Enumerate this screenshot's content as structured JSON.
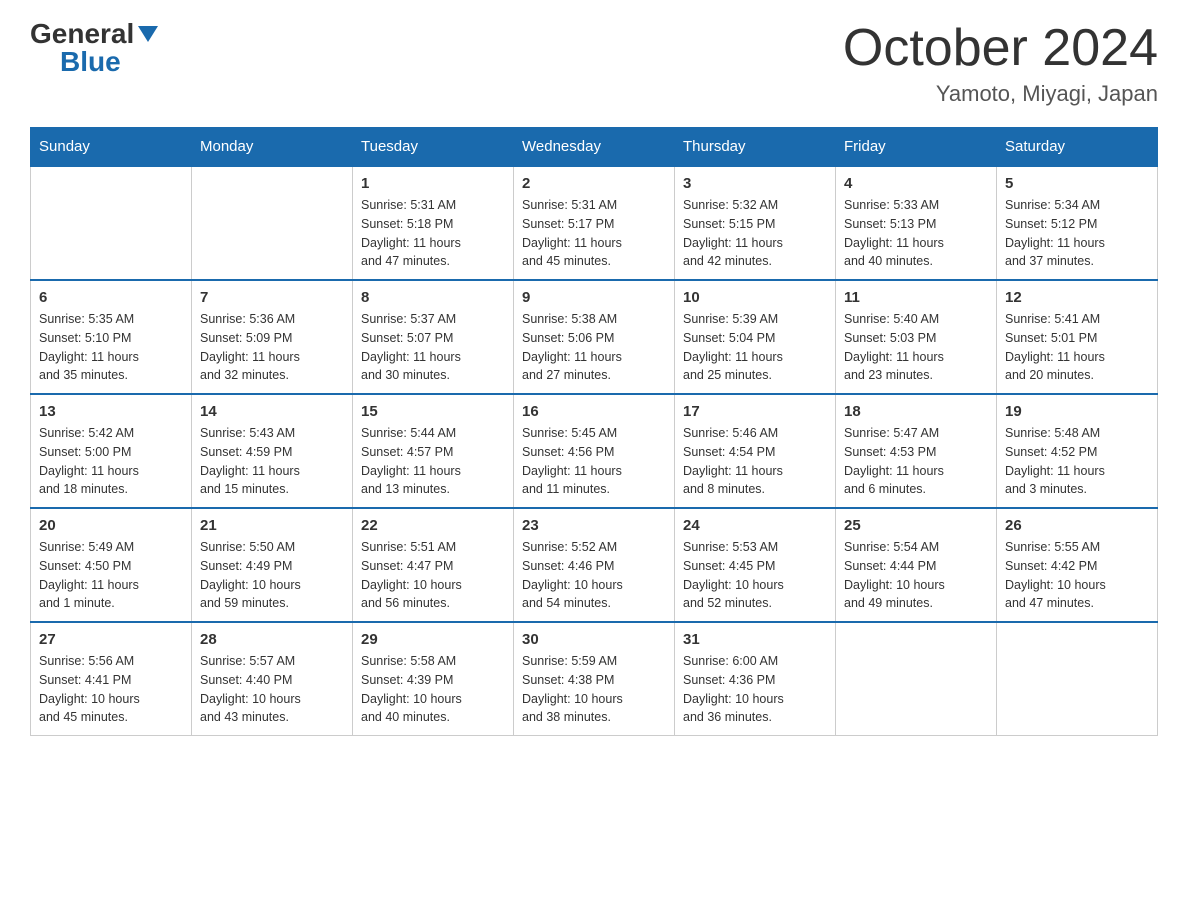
{
  "header": {
    "logo_general": "General",
    "logo_blue": "Blue",
    "title": "October 2024",
    "subtitle": "Yamoto, Miyagi, Japan"
  },
  "columns": [
    "Sunday",
    "Monday",
    "Tuesday",
    "Wednesday",
    "Thursday",
    "Friday",
    "Saturday"
  ],
  "weeks": [
    [
      {
        "day": "",
        "info": ""
      },
      {
        "day": "",
        "info": ""
      },
      {
        "day": "1",
        "info": "Sunrise: 5:31 AM\nSunset: 5:18 PM\nDaylight: 11 hours\nand 47 minutes."
      },
      {
        "day": "2",
        "info": "Sunrise: 5:31 AM\nSunset: 5:17 PM\nDaylight: 11 hours\nand 45 minutes."
      },
      {
        "day": "3",
        "info": "Sunrise: 5:32 AM\nSunset: 5:15 PM\nDaylight: 11 hours\nand 42 minutes."
      },
      {
        "day": "4",
        "info": "Sunrise: 5:33 AM\nSunset: 5:13 PM\nDaylight: 11 hours\nand 40 minutes."
      },
      {
        "day": "5",
        "info": "Sunrise: 5:34 AM\nSunset: 5:12 PM\nDaylight: 11 hours\nand 37 minutes."
      }
    ],
    [
      {
        "day": "6",
        "info": "Sunrise: 5:35 AM\nSunset: 5:10 PM\nDaylight: 11 hours\nand 35 minutes."
      },
      {
        "day": "7",
        "info": "Sunrise: 5:36 AM\nSunset: 5:09 PM\nDaylight: 11 hours\nand 32 minutes."
      },
      {
        "day": "8",
        "info": "Sunrise: 5:37 AM\nSunset: 5:07 PM\nDaylight: 11 hours\nand 30 minutes."
      },
      {
        "day": "9",
        "info": "Sunrise: 5:38 AM\nSunset: 5:06 PM\nDaylight: 11 hours\nand 27 minutes."
      },
      {
        "day": "10",
        "info": "Sunrise: 5:39 AM\nSunset: 5:04 PM\nDaylight: 11 hours\nand 25 minutes."
      },
      {
        "day": "11",
        "info": "Sunrise: 5:40 AM\nSunset: 5:03 PM\nDaylight: 11 hours\nand 23 minutes."
      },
      {
        "day": "12",
        "info": "Sunrise: 5:41 AM\nSunset: 5:01 PM\nDaylight: 11 hours\nand 20 minutes."
      }
    ],
    [
      {
        "day": "13",
        "info": "Sunrise: 5:42 AM\nSunset: 5:00 PM\nDaylight: 11 hours\nand 18 minutes."
      },
      {
        "day": "14",
        "info": "Sunrise: 5:43 AM\nSunset: 4:59 PM\nDaylight: 11 hours\nand 15 minutes."
      },
      {
        "day": "15",
        "info": "Sunrise: 5:44 AM\nSunset: 4:57 PM\nDaylight: 11 hours\nand 13 minutes."
      },
      {
        "day": "16",
        "info": "Sunrise: 5:45 AM\nSunset: 4:56 PM\nDaylight: 11 hours\nand 11 minutes."
      },
      {
        "day": "17",
        "info": "Sunrise: 5:46 AM\nSunset: 4:54 PM\nDaylight: 11 hours\nand 8 minutes."
      },
      {
        "day": "18",
        "info": "Sunrise: 5:47 AM\nSunset: 4:53 PM\nDaylight: 11 hours\nand 6 minutes."
      },
      {
        "day": "19",
        "info": "Sunrise: 5:48 AM\nSunset: 4:52 PM\nDaylight: 11 hours\nand 3 minutes."
      }
    ],
    [
      {
        "day": "20",
        "info": "Sunrise: 5:49 AM\nSunset: 4:50 PM\nDaylight: 11 hours\nand 1 minute."
      },
      {
        "day": "21",
        "info": "Sunrise: 5:50 AM\nSunset: 4:49 PM\nDaylight: 10 hours\nand 59 minutes."
      },
      {
        "day": "22",
        "info": "Sunrise: 5:51 AM\nSunset: 4:47 PM\nDaylight: 10 hours\nand 56 minutes."
      },
      {
        "day": "23",
        "info": "Sunrise: 5:52 AM\nSunset: 4:46 PM\nDaylight: 10 hours\nand 54 minutes."
      },
      {
        "day": "24",
        "info": "Sunrise: 5:53 AM\nSunset: 4:45 PM\nDaylight: 10 hours\nand 52 minutes."
      },
      {
        "day": "25",
        "info": "Sunrise: 5:54 AM\nSunset: 4:44 PM\nDaylight: 10 hours\nand 49 minutes."
      },
      {
        "day": "26",
        "info": "Sunrise: 5:55 AM\nSunset: 4:42 PM\nDaylight: 10 hours\nand 47 minutes."
      }
    ],
    [
      {
        "day": "27",
        "info": "Sunrise: 5:56 AM\nSunset: 4:41 PM\nDaylight: 10 hours\nand 45 minutes."
      },
      {
        "day": "28",
        "info": "Sunrise: 5:57 AM\nSunset: 4:40 PM\nDaylight: 10 hours\nand 43 minutes."
      },
      {
        "day": "29",
        "info": "Sunrise: 5:58 AM\nSunset: 4:39 PM\nDaylight: 10 hours\nand 40 minutes."
      },
      {
        "day": "30",
        "info": "Sunrise: 5:59 AM\nSunset: 4:38 PM\nDaylight: 10 hours\nand 38 minutes."
      },
      {
        "day": "31",
        "info": "Sunrise: 6:00 AM\nSunset: 4:36 PM\nDaylight: 10 hours\nand 36 minutes."
      },
      {
        "day": "",
        "info": ""
      },
      {
        "day": "",
        "info": ""
      }
    ]
  ]
}
